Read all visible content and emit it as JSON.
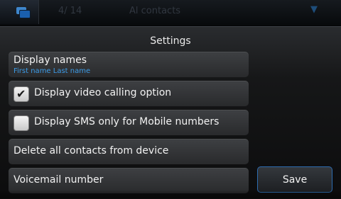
{
  "statusbar": {
    "dim_left": "4/ 14",
    "dim_center": "Al contacts",
    "chevron_icon": "chevron-down-icon",
    "task_icon": "task-switcher-icon"
  },
  "dialog": {
    "title": "Settings",
    "display_names": {
      "label": "Display names",
      "value": "First name Last name"
    },
    "video_calling": {
      "label": "Display video calling option",
      "checked": true
    },
    "sms_only": {
      "label": "Display SMS only for Mobile numbers",
      "checked": false
    },
    "delete_all": {
      "label": "Delete all contacts from device"
    },
    "voicemail": {
      "label": "Voicemail number"
    },
    "save_label": "Save"
  },
  "colors": {
    "accent": "#3c9be6",
    "button_border": "#2d6cb0",
    "row_bg": "#353739"
  }
}
